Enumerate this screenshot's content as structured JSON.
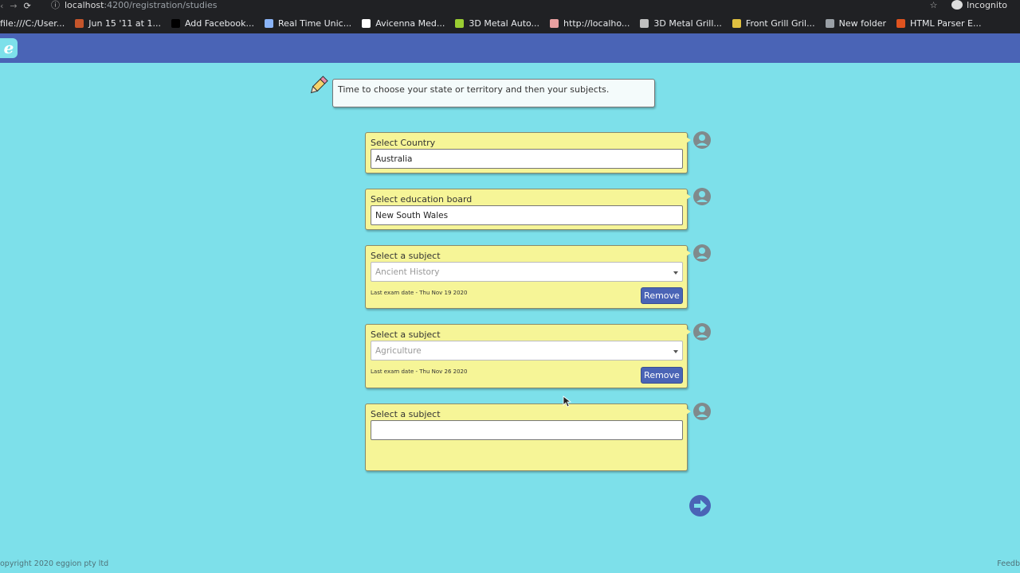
{
  "browser": {
    "url_host": "localhost",
    "url_path": ":4200/registration/studies",
    "profile": "Incognito",
    "bookmarks": [
      {
        "label": "file:///C:/User...",
        "color": "#5f6368"
      },
      {
        "label": "Jun 15 '11 at 1...",
        "color": "#c5552b"
      },
      {
        "label": "Add Facebook...",
        "color": "#000000"
      },
      {
        "label": "Real Time Unic...",
        "color": "#8ab4f8"
      },
      {
        "label": "Avicenna Med...",
        "color": "#ffffff"
      },
      {
        "label": "3D Metal Auto...",
        "color": "#9acd32"
      },
      {
        "label": "http://localho...",
        "color": "#e8a0a0"
      },
      {
        "label": "3D Metal Grill...",
        "color": "#c0c0c0"
      },
      {
        "label": "Front Grill Gril...",
        "color": "#e0c040"
      },
      {
        "label": "New folder",
        "color": "#9aa0a6"
      },
      {
        "label": "HTML Parser E...",
        "color": "#e0531f"
      }
    ]
  },
  "header": {
    "logo_letter": "e"
  },
  "intro": {
    "message": "Time to choose your state or territory and then your subjects."
  },
  "country": {
    "label": "Select Country",
    "value": "Australia"
  },
  "board": {
    "label": "Select education board",
    "value": "New South Wales"
  },
  "subjects": [
    {
      "label": "Select a subject",
      "value": "Ancient History",
      "meta": "Last exam date - Thu Nov 19 2020",
      "remove_label": "Remove"
    },
    {
      "label": "Select a subject",
      "value": "Agriculture",
      "meta": "Last exam date - Thu Nov 26 2020",
      "remove_label": "Remove"
    },
    {
      "label": "Select a subject",
      "value": ""
    }
  ],
  "footer": {
    "copyright": "opyright 2020 eggion pty ltd",
    "feedback": "Feedb"
  },
  "colors": {
    "background": "#7de0ea",
    "header": "#4a64b6",
    "card": "#f6f597",
    "button": "#4a64b6"
  }
}
